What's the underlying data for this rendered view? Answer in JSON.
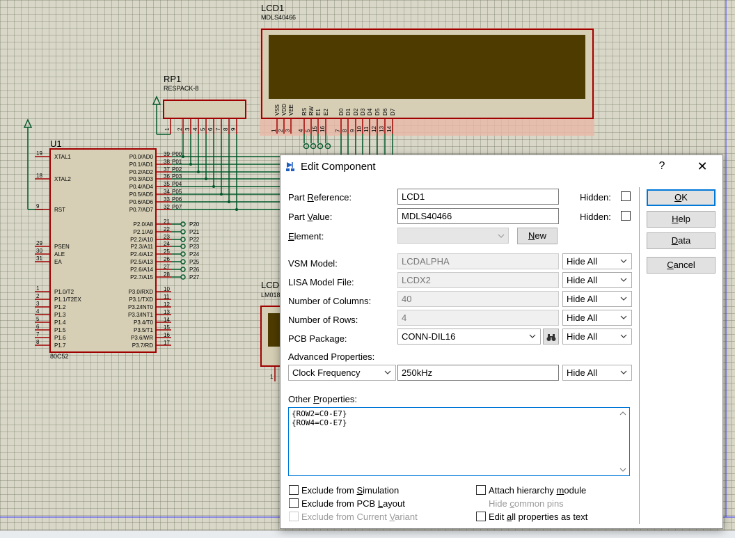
{
  "schematic": {
    "lcd1": {
      "ref": "LCD1",
      "value": "MDLS40466",
      "pin_names": [
        "VSS",
        "VDD",
        "VEE",
        "RS",
        "RW",
        "E1",
        "E2",
        "D0",
        "D1",
        "D2",
        "D3",
        "D4",
        "D5",
        "D6",
        "D7"
      ],
      "pin_nums": [
        "1",
        "2",
        "3",
        "4",
        "5",
        "15",
        "16",
        "7",
        "8",
        "9",
        "10",
        "11",
        "12",
        "13",
        "14"
      ]
    },
    "rp1": {
      "ref": "RP1",
      "value": "RESPACK-8",
      "pins": [
        "1",
        "2",
        "3",
        "4",
        "5",
        "6",
        "7",
        "8",
        "9"
      ]
    },
    "u1": {
      "ref": "U1",
      "value": "80C52",
      "left_pins": [
        {
          "num": "19",
          "name": "XTAL1"
        },
        {
          "num": "18",
          "name": "XTAL2"
        },
        {
          "num": "9",
          "name": "RST"
        },
        {
          "num": "29",
          "name": "PSEN"
        },
        {
          "num": "30",
          "name": "ALE"
        },
        {
          "num": "31",
          "name": "EA"
        },
        {
          "num": "1",
          "name": "P1.0/T2"
        },
        {
          "num": "2",
          "name": "P1.1/T2EX"
        },
        {
          "num": "3",
          "name": "P1.2"
        },
        {
          "num": "4",
          "name": "P1.3"
        },
        {
          "num": "5",
          "name": "P1.4"
        },
        {
          "num": "6",
          "name": "P1.5"
        },
        {
          "num": "7",
          "name": "P1.6"
        },
        {
          "num": "8",
          "name": "P1.7"
        }
      ],
      "port0": [
        {
          "num": "39",
          "name": "P0.0/AD0",
          "net": "P00"
        },
        {
          "num": "38",
          "name": "P0.1/AD1",
          "net": "P01"
        },
        {
          "num": "37",
          "name": "P0.2/AD2",
          "net": "P02"
        },
        {
          "num": "36",
          "name": "P0.3/AD3",
          "net": "P03"
        },
        {
          "num": "35",
          "name": "P0.4/AD4",
          "net": "P04"
        },
        {
          "num": "34",
          "name": "P0.5/AD5",
          "net": "P05"
        },
        {
          "num": "33",
          "name": "P0.6/AD6",
          "net": "P06"
        },
        {
          "num": "32",
          "name": "P0.7/AD7",
          "net": "P07"
        }
      ],
      "port2": [
        {
          "num": "21",
          "name": "P2.0/A8",
          "net": "P20"
        },
        {
          "num": "22",
          "name": "P2.1/A9",
          "net": "P21"
        },
        {
          "num": "23",
          "name": "P2.2/A10",
          "net": "P22"
        },
        {
          "num": "24",
          "name": "P2.3/A11",
          "net": "P23"
        },
        {
          "num": "25",
          "name": "P2.4/A12",
          "net": "P24"
        },
        {
          "num": "26",
          "name": "P2.5/A13",
          "net": "P25"
        },
        {
          "num": "27",
          "name": "P2.6/A14",
          "net": "P26"
        },
        {
          "num": "28",
          "name": "P2.7/A15",
          "net": "P27"
        }
      ],
      "port3": [
        {
          "num": "10",
          "name": "P3.0/RXD"
        },
        {
          "num": "11",
          "name": "P3.1/TXD"
        },
        {
          "num": "12",
          "name": "P3.2/INT0"
        },
        {
          "num": "13",
          "name": "P3.3/INT1"
        },
        {
          "num": "14",
          "name": "P3.4/T0"
        },
        {
          "num": "15",
          "name": "P3.5/T1"
        },
        {
          "num": "16",
          "name": "P3.6/WR"
        },
        {
          "num": "17",
          "name": "P3.7/RD"
        }
      ]
    },
    "lcd2": {
      "ref": "LCD",
      "value": "LM018",
      "pin1": "1"
    }
  },
  "dialog": {
    "title": "Edit Component",
    "help_glyph": "?",
    "close_glyph": "✕",
    "part_reference": {
      "label_pre": "Part ",
      "label_u": "R",
      "label_post": "eference:",
      "value": "LCD1",
      "hidden_label": "Hidden:"
    },
    "part_value": {
      "label_pre": "Part ",
      "label_u": "V",
      "label_post": "alue:",
      "value": "MDLS40466",
      "hidden_label": "Hidden:"
    },
    "element": {
      "label_u": "E",
      "label_post": "lement:",
      "value": "",
      "new_u": "N",
      "new_post": "ew"
    },
    "props": [
      {
        "label": "VSM Model:",
        "value": "LCDALPHA",
        "visibility": "Hide All"
      },
      {
        "label": "LISA Model File:",
        "value": "LCDX2",
        "visibility": "Hide All"
      },
      {
        "label": "Number of Columns:",
        "value": "40",
        "visibility": "Hide All"
      },
      {
        "label": "Number of Rows:",
        "value": "4",
        "visibility": "Hide All"
      }
    ],
    "pcb_package": {
      "label": "PCB Package:",
      "value": "CONN-DIL16",
      "visibility": "Hide All"
    },
    "advanced": {
      "label": "Advanced Properties:",
      "name": "Clock Frequency",
      "value": "250kHz",
      "visibility": "Hide All"
    },
    "other": {
      "label_pre": "Other ",
      "label_u": "P",
      "label_post": "roperties:",
      "text": "{ROW2=C0-E7}\n{ROW4=C0-E7}"
    },
    "checks": {
      "exclude_sim": {
        "pre": "Exclude from ",
        "u": "S",
        "post": "imulation",
        "checked": false
      },
      "exclude_pcb": {
        "pre": "Exclude from PCB ",
        "u": "L",
        "post": "ayout",
        "checked": false
      },
      "exclude_variant": {
        "pre": "Exclude from Current ",
        "u": "V",
        "post": "ariant",
        "checked": false
      },
      "attach_hier": {
        "pre": "Attach hierarchy ",
        "u": "m",
        "post": "odule",
        "checked": false
      },
      "hide_common": {
        "pre": "Hide ",
        "u": "c",
        "post": "ommon pins",
        "checked": false
      },
      "edit_all": {
        "pre": "Edit ",
        "u": "a",
        "post": "ll properties as text",
        "checked": false
      }
    },
    "buttons": {
      "ok": {
        "u": "O",
        "post": "K"
      },
      "help": {
        "u": "H",
        "post": "elp"
      },
      "data": {
        "u": "D",
        "post": "ata"
      },
      "cancel": {
        "u": "C",
        "post": "ancel"
      }
    }
  },
  "colors": {
    "component_border": "#a00000",
    "component_fill": "#d8d0b4",
    "lcd_screen": "#4d3b00",
    "wire": "#00582a",
    "accent": "#0078d7"
  }
}
